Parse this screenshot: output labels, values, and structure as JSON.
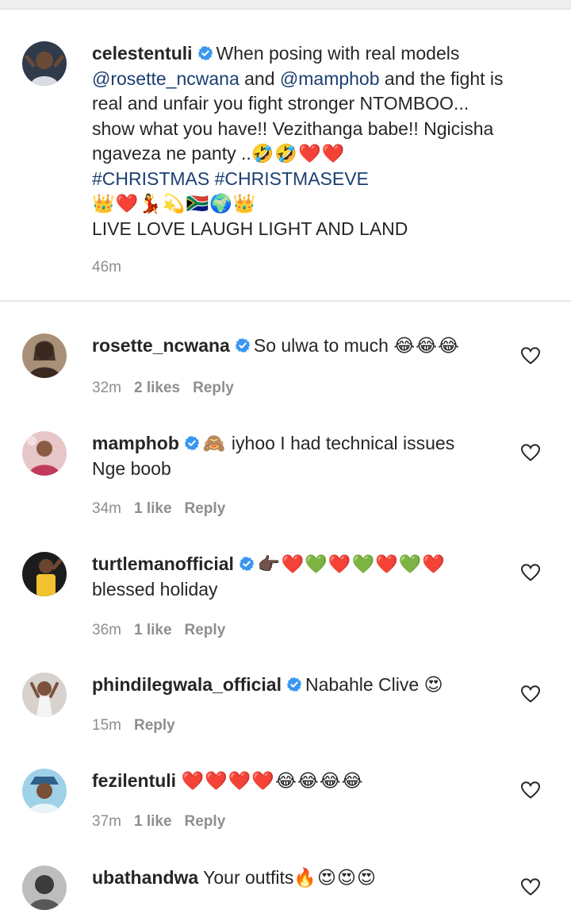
{
  "caption": {
    "username": "celestentuli",
    "lines": [
      {
        "pre": "When posing with real models"
      },
      {
        "m1": "@rosette_ncwana",
        "mid": " and ",
        "m2": "@mamphob",
        "post": " and the fight is"
      },
      {
        "text": "real and unfair you fight stronger NTOMBOO..."
      },
      {
        "text": "show what you have!! Vezithanga babe!! Ngicisha"
      },
      {
        "text": "ngaveza ne panty ..",
        "emoji": "🤣🤣❤️❤️"
      },
      {
        "tags": "#CHRISTMAS #CHRISTMASEVE"
      },
      {
        "emoji": "👑❤️💃💫🇿🇦🌍👑"
      },
      {
        "text": "LIVE LOVE LAUGH LIGHT AND LAND"
      }
    ],
    "time": "46m"
  },
  "comments": [
    {
      "username": "rosette_ncwana",
      "text": "So ulwa to much",
      "emoji": "😂😂😂",
      "time": "32m",
      "likes": "2 likes",
      "reply": "Reply"
    },
    {
      "username": "mamphob",
      "emoji": "🙈",
      "text": "iyhoo I had technical issues",
      "text2": "Nge boob",
      "time": "34m",
      "likes": "1 like",
      "reply": "Reply"
    },
    {
      "username": "turtlemanofficial",
      "emoji": "👉🏿❤️💚❤️💚❤️💚❤️",
      "text2": "blessed holiday",
      "time": "36m",
      "likes": "1 like",
      "reply": "Reply"
    },
    {
      "username": "phindilegwala_official",
      "text": "Nabahle Clive",
      "emoji": "😍",
      "time": "15m",
      "reply": "Reply"
    },
    {
      "username": "fezilentuli",
      "emoji": "❤️❤️❤️❤️😂😂😂😂",
      "time": "37m",
      "likes": "1 like",
      "reply": "Reply"
    },
    {
      "username": "ubathandwa",
      "text": "Your outfits",
      "emoji": "🔥😍😍😍"
    }
  ],
  "colors": {
    "mention": "#1b3f72",
    "verified": "#3897f0",
    "muted": "#8e8e8e"
  }
}
